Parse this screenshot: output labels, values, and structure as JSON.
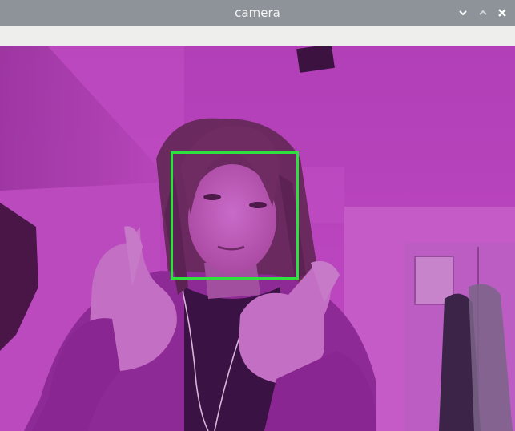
{
  "window": {
    "title": "camera",
    "controls": {
      "minimize_icon": "chevron-down-icon",
      "maximize_icon": "chevron-up-icon",
      "close_icon": "close-icon"
    }
  },
  "video": {
    "tint_color": "#b23eb6",
    "detection": {
      "color": "#2fe13f",
      "label": "face"
    }
  }
}
